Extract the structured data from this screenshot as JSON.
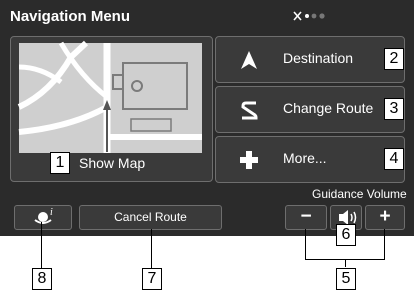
{
  "header": {
    "title": "Navigation Menu"
  },
  "map_panel": {
    "label": "Show Map",
    "callout": "1"
  },
  "menu": [
    {
      "label": "Destination",
      "icon": "arrow-up-icon",
      "callout": "2"
    },
    {
      "label": "Change Route",
      "icon": "reroute-icon",
      "callout": "3"
    },
    {
      "label": "More...",
      "icon": "plus-icon",
      "callout": "4"
    }
  ],
  "volume": {
    "label": "Guidance Volume",
    "minus": "−",
    "plus": "+",
    "callout_group": "5",
    "callout_speaker": "6"
  },
  "cancel_route": {
    "label": "Cancel Route",
    "callout": "7"
  },
  "info_button": {
    "icon": "traffic-info-icon",
    "callout": "8"
  },
  "colors": {
    "screen_bg": "#2b2b2b",
    "button_bg": "#3a3a3a",
    "border": "#6e6e6e"
  }
}
